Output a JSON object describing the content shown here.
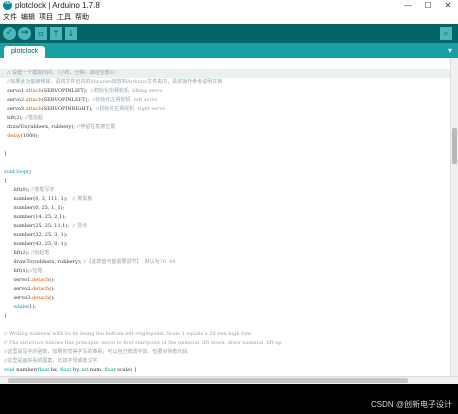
{
  "window": {
    "title": "plotclock | Arduino 1.7.8",
    "minimize": "—",
    "maximize": "☐",
    "close": "✕"
  },
  "menu": [
    "文件",
    "编辑",
    "项目",
    "工具",
    "帮助"
  ],
  "toolbar": {
    "verify": "✓",
    "upload": "→",
    "new": "▫",
    "open": "↑",
    "save": "↓",
    "serial_monitor": "⌕"
  },
  "tab": {
    "name": "plotclock",
    "menu_arrow": "▾"
  },
  "code_lines": [
    {
      "parts": [
        {
          "t": ""
        }
      ]
    },
    {
      "parts": [
        {
          "t": "  // 设置一个模拟时间，（小时，分钟，启动全部0）",
          "c": "cm"
        }
      ]
    },
    {
      "parts": [
        {
          "t": "  //如果此功能被移除，请将文件包内的libraries库放到Arduino文件夹内，具体操作参考说明文档",
          "c": "cm"
        }
      ]
    },
    {
      "parts": [
        {
          "t": "  servo1.",
          "c": ""
        },
        {
          "t": "attach",
          "c": "fn"
        },
        {
          "t": "(SERVOPINLIFT);  ",
          "c": ""
        },
        {
          "t": "//初始化抬臂舵机  lifting servo",
          "c": "cm"
        }
      ]
    },
    {
      "parts": [
        {
          "t": "  servo2.",
          "c": ""
        },
        {
          "t": "attach",
          "c": "fn"
        },
        {
          "t": "(SERVOPINLEFT);  ",
          "c": ""
        },
        {
          "t": "//初始化左臂舵机  left servo",
          "c": "cm"
        }
      ]
    },
    {
      "parts": [
        {
          "t": "  servo3.",
          "c": ""
        },
        {
          "t": "attach",
          "c": "fn"
        },
        {
          "t": "(SERVOPINRIGHT);  ",
          "c": ""
        },
        {
          "t": "//初始化右臂舵机  right servo",
          "c": "cm"
        }
      ]
    },
    {
      "parts": [
        {
          "t": "  lift(2); ",
          "c": ""
        },
        {
          "t": "//笔抬起",
          "c": "cm"
        }
      ]
    },
    {
      "parts": [
        {
          "t": "  drawTo(rubberx, rubbery); ",
          "c": ""
        },
        {
          "t": "//停留在笔擦位置",
          "c": "cm"
        }
      ]
    },
    {
      "parts": [
        {
          "t": "  ",
          "c": ""
        },
        {
          "t": "delay",
          "c": "fn"
        },
        {
          "t": "(1000);",
          "c": ""
        }
      ]
    },
    {
      "parts": [
        {
          "t": ""
        }
      ]
    },
    {
      "parts": [
        {
          "t": "}"
        }
      ]
    },
    {
      "parts": [
        {
          "t": ""
        }
      ]
    },
    {
      "parts": [
        {
          "t": "void",
          "c": "kw"
        },
        {
          "t": " ",
          "c": ""
        },
        {
          "t": "loop",
          "c": "kw"
        },
        {
          "t": "()",
          "c": ""
        }
      ]
    },
    {
      "parts": [
        {
          "t": "{"
        }
      ]
    },
    {
      "parts": [
        {
          "t": "      lift(0); ",
          "c": ""
        },
        {
          "t": "//落笔写字",
          "c": "cm"
        }
      ]
    },
    {
      "parts": [
        {
          "t": "      number(0, 3, 111, 1);   ",
          "c": ""
        },
        {
          "t": "// 擦黑板",
          "c": "cm"
        }
      ]
    },
    {
      "parts": [
        {
          "t": "      number(0, 25, 1, 1);"
        }
      ]
    },
    {
      "parts": [
        {
          "t": "      number(14, 25, 2,1);"
        }
      ]
    },
    {
      "parts": [
        {
          "t": "      number(25, 25, 11,1);  ",
          "c": ""
        },
        {
          "t": "// 冒点",
          "c": "cm"
        }
      ]
    },
    {
      "parts": [
        {
          "t": "      number(32, 25, 3, 1);"
        }
      ]
    },
    {
      "parts": [
        {
          "t": "      number(43, 25, 0, 1);"
        }
      ]
    },
    {
      "parts": [
        {
          "t": "      lift(2); ",
          "c": ""
        },
        {
          "t": "//抬起笔",
          "c": "cm"
        }
      ]
    },
    {
      "parts": [
        {
          "t": "      drawTo(rubberx, rubbery); ",
          "c": ""
        },
        {
          "t": "//【此数值可能需要调节】  默认为70  44",
          "c": "cm"
        }
      ]
    },
    {
      "parts": [
        {
          "t": "      lift(1);",
          "c": ""
        },
        {
          "t": "//抬笔",
          "c": "cm"
        }
      ]
    },
    {
      "parts": [
        {
          "t": "      servo1.",
          "c": ""
        },
        {
          "t": "detach",
          "c": "fn"
        },
        {
          "t": "();",
          "c": ""
        }
      ]
    },
    {
      "parts": [
        {
          "t": "      servo2.",
          "c": ""
        },
        {
          "t": "detach",
          "c": "fn"
        },
        {
          "t": "();",
          "c": ""
        }
      ]
    },
    {
      "parts": [
        {
          "t": "      servo3.",
          "c": ""
        },
        {
          "t": "detach",
          "c": "fn"
        },
        {
          "t": "();",
          "c": ""
        }
      ]
    },
    {
      "parts": [
        {
          "t": "      ",
          "c": ""
        },
        {
          "t": "while",
          "c": "kw"
        },
        {
          "t": "(1);",
          "c": ""
        }
      ]
    },
    {
      "parts": [
        {
          "t": "}"
        }
      ]
    },
    {
      "parts": [
        {
          "t": ""
        }
      ]
    },
    {
      "parts": [
        {
          "t": "// Writing numeral with bx by being the bottom left originpoint. Scale 1 equals a 20 mm high font.",
          "c": "cm"
        }
      ]
    },
    {
      "parts": [
        {
          "t": "// The structure follows this principle: move to first startpoint of the numeral, lift down, draw numeral, lift up",
          "c": "cm"
        }
      ]
    },
    {
      "parts": [
        {
          "t": "//这里是写字的函数，如果你觉得字写的难看，可以自己修改字体，但要对熟悉代码",
          "c": "cm"
        }
      ]
    },
    {
      "parts": [
        {
          "t": "//这里是画好看的图案，比如字母或者汉字",
          "c": "cm"
        }
      ]
    },
    {
      "parts": [
        {
          "t": "void",
          "c": "kw"
        },
        {
          "t": " number(",
          "c": ""
        },
        {
          "t": "float",
          "c": "kw"
        },
        {
          "t": " bx, ",
          "c": ""
        },
        {
          "t": "float",
          "c": "kw"
        },
        {
          "t": " by, ",
          "c": ""
        },
        {
          "t": "int",
          "c": "kw"
        },
        {
          "t": " num, ",
          "c": ""
        },
        {
          "t": "float",
          "c": "kw"
        },
        {
          "t": " scale) {",
          "c": ""
        }
      ]
    }
  ],
  "highlight_line": 1,
  "watermark": "CSDN @创新电子设计"
}
